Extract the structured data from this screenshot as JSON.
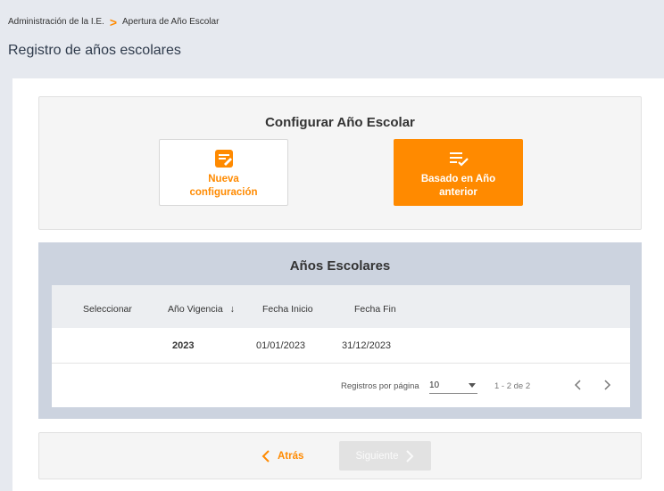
{
  "breadcrumb": {
    "items": [
      "Administración de la I.E.",
      "Apertura de Año Escolar"
    ],
    "separator": ">"
  },
  "page_title": "Registro de años escolares",
  "config": {
    "title": "Configurar Año Escolar",
    "options": [
      {
        "label_line1": "Nueva",
        "label_line2": "configuración",
        "icon": "edit-note-icon"
      },
      {
        "label_line1": "Basado en Año",
        "label_line2": "anterior",
        "icon": "checklist-icon"
      }
    ]
  },
  "years": {
    "title": "Años Escolares",
    "columns": [
      "Seleccionar",
      "Año Vigencia",
      "Fecha Inicio",
      "Fecha Fin"
    ],
    "sort_arrow": "↓",
    "rows": [
      {
        "anio": "2023",
        "fecha_inicio": "01/01/2023",
        "fecha_fin": "31/12/2023"
      }
    ],
    "pager": {
      "label": "Registros por página",
      "page_size": "10",
      "range": "1 - 2 de 2"
    }
  },
  "nav": {
    "back_label": "Atrás",
    "next_label": "Siguiente"
  },
  "colors": {
    "accent": "#ff8a00",
    "panel": "#ccd3df",
    "disabled": "#e2e2e2"
  }
}
